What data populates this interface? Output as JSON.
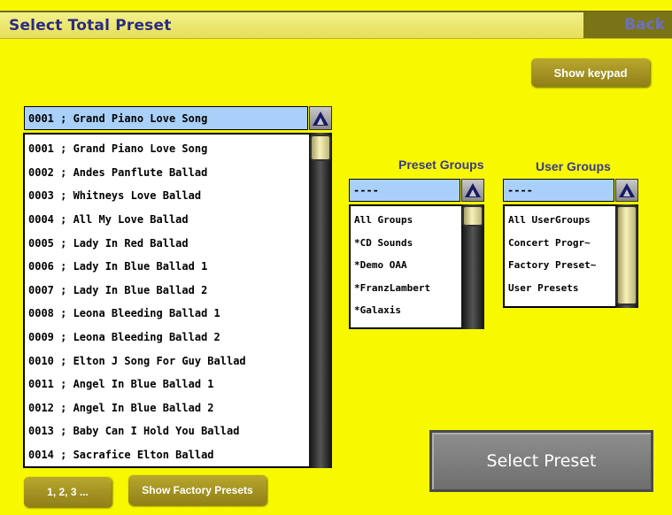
{
  "header": {
    "title": "Select Total Preset",
    "back_label": "Back"
  },
  "buttons": {
    "show_keypad": "Show keypad",
    "numeric": "1, 2, 3 ...",
    "show_factory": "Show Factory Presets",
    "select_preset": "Select Preset"
  },
  "preset_list": {
    "selected": "0001 ; Grand Piano Love Song",
    "items": [
      "0001 ; Grand Piano Love Song",
      "0002 ; Andes Panflute Ballad",
      "0003 ; Whitneys Love Ballad",
      "0004 ; All My Love Ballad",
      "0005 ; Lady In Red Ballad",
      "0006 ; Lady In Blue Ballad 1",
      "0007 ; Lady In Blue Ballad 2",
      "0008 ; Leona Bleeding Ballad 1",
      "0009 ; Leona Bleeding Ballad 2",
      "0010 ; Elton J Song For Guy Ballad",
      "0011 ; Angel In Blue Ballad 1",
      "0012 ; Angel In Blue Ballad 2",
      "0013 ; Baby Can I Hold You Ballad",
      "0014 ; Sacrafice Elton Ballad"
    ]
  },
  "preset_groups": {
    "label": "Preset Groups",
    "selected": "----",
    "items": [
      "All Groups",
      "*CD Sounds",
      "*Demo OAA",
      "*FranzLambert",
      "*Galaxis"
    ]
  },
  "user_groups": {
    "label": "User Groups",
    "selected": "----",
    "items": [
      "All UserGroups",
      "Concert Progr~",
      "Factory Preset~",
      "User Presets"
    ]
  },
  "colors": {
    "background": "#f8f800",
    "selection": "#a9d0f8",
    "accent_gold": "#9d8e22",
    "title_text": "#2a2a86"
  },
  "icons": {
    "scroll_up": "up-arrow-icon"
  }
}
